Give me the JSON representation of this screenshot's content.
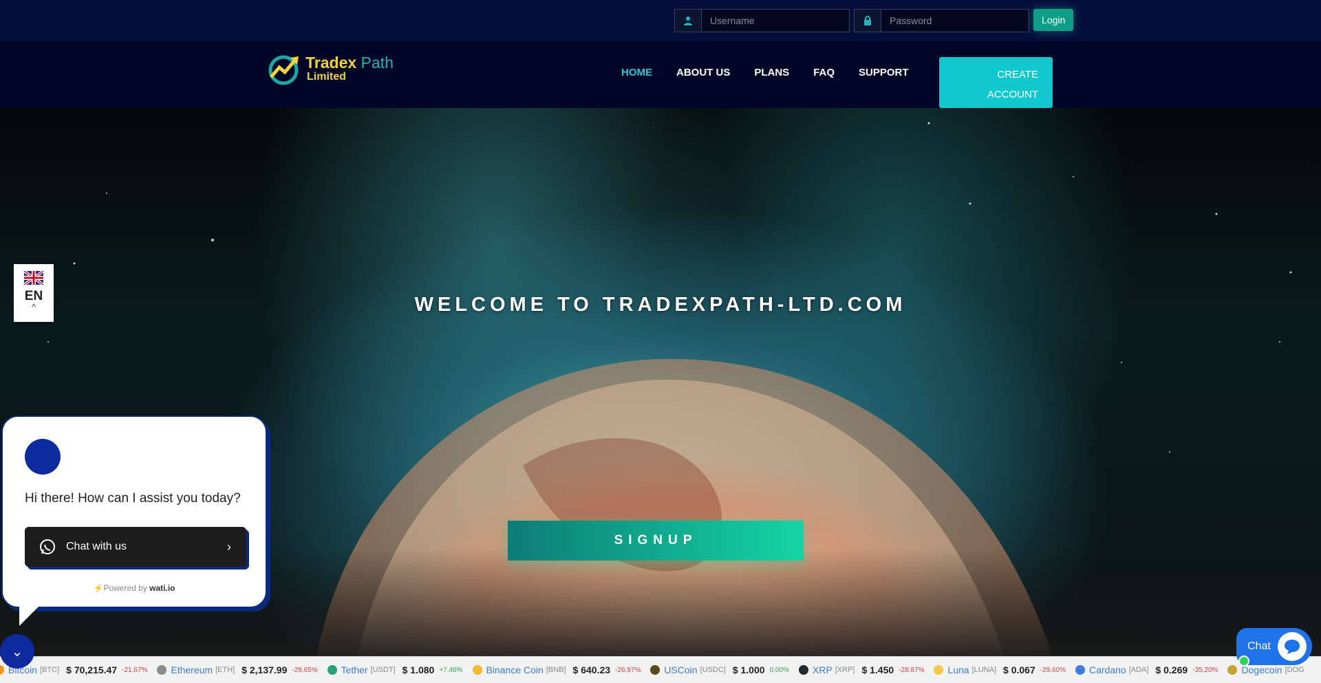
{
  "login": {
    "username_placeholder": "Username",
    "password_placeholder": "Password",
    "login_label": "Login"
  },
  "brand": {
    "name_part1": "Tradex",
    "name_part2": " Path",
    "subtitle": "Limited"
  },
  "nav": {
    "items": [
      {
        "label": "HOME",
        "active": true
      },
      {
        "label": "ABOUT US",
        "active": false
      },
      {
        "label": "PLANS",
        "active": false
      },
      {
        "label": "FAQ",
        "active": false
      },
      {
        "label": "SUPPORT",
        "active": false
      }
    ],
    "create_line1": "CREATE",
    "create_line2": "ACCOUNT"
  },
  "hero": {
    "title": "WELCOME TO TRADEXPATH-LTD.COM",
    "signup_label": "SIGNUP"
  },
  "language": {
    "code": "EN"
  },
  "chat_widget": {
    "message": "Hi there! How can I assist you today?",
    "cta_label": "Chat with us",
    "powered_prefix": "Powered by ",
    "powered_brand": "wati.io"
  },
  "chat_button": {
    "label": "Chat"
  },
  "ticker": [
    {
      "name": "Bitcoin",
      "symbol": "[BTC]",
      "price": "$ 70,215.47",
      "change": "-21.67%",
      "trend": "neg",
      "color": "#f7931a"
    },
    {
      "name": "Ethereum",
      "symbol": "[ETH]",
      "price": "$ 2,137.99",
      "change": "-29.65%",
      "trend": "neg",
      "color": "#8a8a8a"
    },
    {
      "name": "Tether",
      "symbol": "[USDT]",
      "price": "$ 1.080",
      "change": "+7.46%",
      "trend": "pos",
      "color": "#26a17b"
    },
    {
      "name": "Binance Coin",
      "symbol": "[BNB]",
      "price": "$ 640.23",
      "change": "-26.97%",
      "trend": "neg",
      "color": "#f3ba2f"
    },
    {
      "name": "USCoin",
      "symbol": "[USDC]",
      "price": "$ 1.000",
      "change": "0.00%",
      "trend": "pos",
      "color": "#5a4a1a"
    },
    {
      "name": "XRP",
      "symbol": "[XRP]",
      "price": "$ 1.450",
      "change": "-28.87%",
      "trend": "neg",
      "color": "#23292f"
    },
    {
      "name": "Luna",
      "symbol": "[LUNA]",
      "price": "$ 0.067",
      "change": "-29.60%",
      "trend": "neg",
      "color": "#f4c84a"
    },
    {
      "name": "Cardano",
      "symbol": "[ADA]",
      "price": "$ 0.269",
      "change": "-35.20%",
      "trend": "neg",
      "color": "#3b7de0"
    },
    {
      "name": "Dogecoin",
      "symbol": "[DOG",
      "price": "",
      "change": "",
      "trend": "neg",
      "color": "#c2a633"
    }
  ]
}
